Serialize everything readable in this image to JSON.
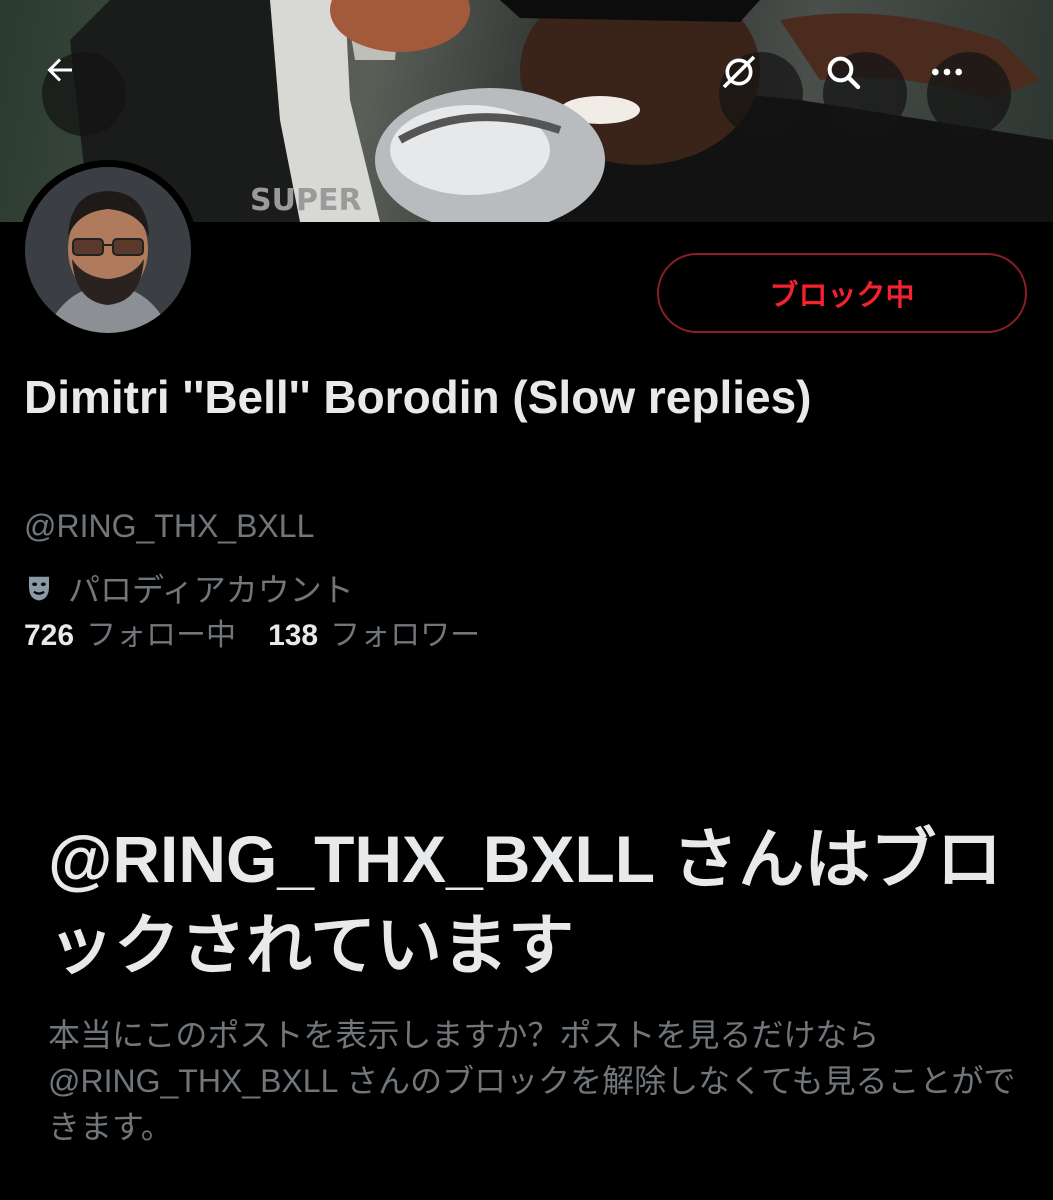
{
  "header": {
    "back_icon": "arrow-left-icon",
    "grok_icon": "grok-icon",
    "search_icon": "search-icon",
    "more_icon": "more-icon"
  },
  "profile": {
    "display_name": "Dimitri ''Bell'' Borodin (Slow replies)",
    "handle": "@RING_THX_BXLL",
    "parody_label": "パロディアカウント",
    "parody_icon": "theater-mask-icon",
    "following_count": "726",
    "following_label": "フォロー中",
    "followers_count": "138",
    "followers_label": "フォロワー",
    "block_button_label": "ブロック中"
  },
  "blocked_notice": {
    "title": "@RING_THX_BXLL さんはブロックされています",
    "description": "本当にこのポストを表示しますか？ポストを見るだけなら@RING_THX_BXLL さんのブロックを解除しなくても見ることができます。"
  },
  "colors": {
    "background": "#000000",
    "text_primary": "#e7e9ea",
    "text_secondary": "#71767b",
    "block_red": "#f4212e",
    "block_border": "#8a1f25"
  }
}
